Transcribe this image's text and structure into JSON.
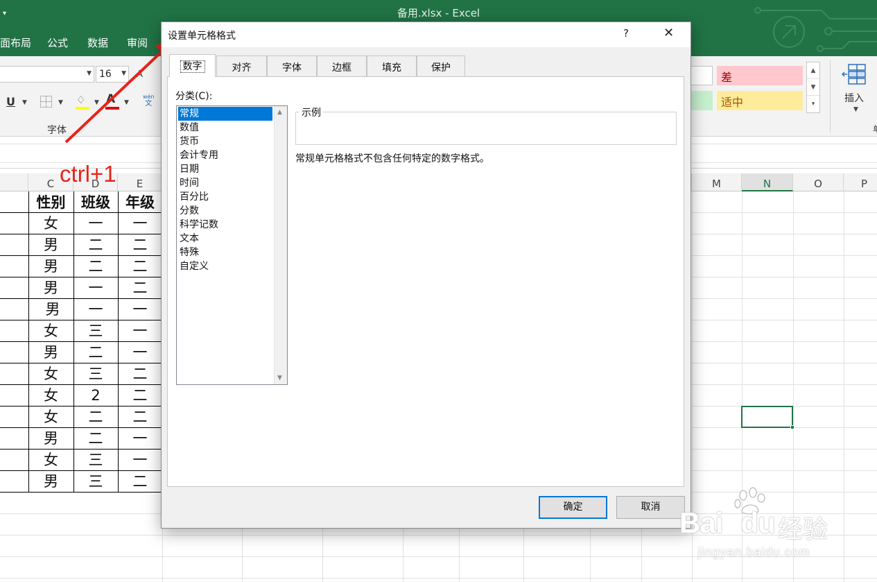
{
  "window": {
    "title": "备用.xlsx  -  Excel",
    "qat_symbol": "▾"
  },
  "ribbon_tabs": [
    {
      "label": "面布局"
    },
    {
      "label": "公式"
    },
    {
      "label": "数据"
    },
    {
      "label": "审阅"
    }
  ],
  "ribbon": {
    "font_size": "16",
    "grow_font": "A",
    "underline": "U",
    "font_color_letter": "A",
    "phonetic_top": "wén",
    "phonetic_bottom": "文",
    "font_group_label": "字体",
    "styles": {
      "bad": "差",
      "neutral": "适中"
    },
    "insert_label": "插入",
    "right_edge_char": "单"
  },
  "colors": {
    "excel_green": "#217346",
    "bad_bg": "#ffc7ce",
    "neutral_bg": "#ffeb9c",
    "good_bg": "#c6efce",
    "annotation_red": "#e8231a",
    "selection_blue": "#0078d7"
  },
  "grid": {
    "columns": [
      "C",
      "D",
      "E",
      "M",
      "N",
      "O",
      "P"
    ],
    "selected_column": "N",
    "headers": [
      "性别",
      "班级",
      "年级"
    ],
    "rows": [
      [
        "女",
        "一",
        "一"
      ],
      [
        "男",
        "二",
        "二"
      ],
      [
        "男",
        "二",
        "二"
      ],
      [
        "男",
        "一",
        "二"
      ],
      [
        "男",
        "一",
        "一"
      ],
      [
        "女",
        "三",
        "一"
      ],
      [
        "男",
        "二",
        "一"
      ],
      [
        "女",
        "三",
        "二"
      ],
      [
        "女",
        "2",
        "二"
      ],
      [
        "女",
        "二",
        "二"
      ],
      [
        "男",
        "二",
        "一"
      ],
      [
        "女",
        "三",
        "一"
      ],
      [
        "男",
        "三",
        "二"
      ]
    ]
  },
  "annotation": {
    "text": "ctrl+1"
  },
  "dialog": {
    "title": "设置单元格格式",
    "help": "?",
    "close": "✕",
    "tabs": [
      "数字",
      "对齐",
      "字体",
      "边框",
      "填充",
      "保护"
    ],
    "active_tab": "数字",
    "category_label": "分类(C):",
    "categories": [
      "常规",
      "数值",
      "货币",
      "会计专用",
      "日期",
      "时间",
      "百分比",
      "分数",
      "科学记数",
      "文本",
      "特殊",
      "自定义"
    ],
    "selected_category": "常规",
    "sample_label": "示例",
    "description": "常规单元格格式不包含任何特定的数字格式。",
    "ok": "确定",
    "cancel": "取消"
  },
  "watermark": {
    "brand": "Bai",
    "brand2": "du",
    "cn": "经验",
    "url": "jingyan.baidu.com"
  }
}
